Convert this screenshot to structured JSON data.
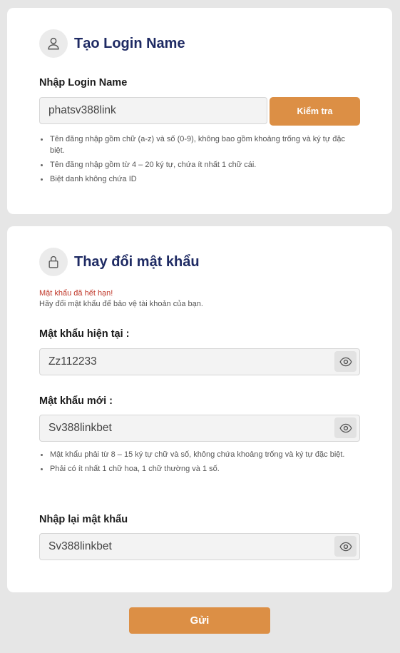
{
  "login_card": {
    "title": "Tạo Login Name",
    "icon": "user-icon",
    "field_label": "Nhập Login Name",
    "field_value": "phatsv388link",
    "check_button": "Kiểm tra",
    "notes": [
      "Tên đăng nhập gồm chữ (a-z) và số (0-9), không bao gồm khoảng trống và ký tự đặc biệt.",
      "Tên đăng nhập gồm từ 4 – 20 ký tự, chứa ít nhất 1 chữ cái.",
      "Biệt danh không chứa ID"
    ]
  },
  "password_card": {
    "title": "Thay đổi mật khẩu",
    "icon": "lock-icon",
    "expired_warning": "Mật khẩu đã hết hạn!",
    "change_hint": "Hãy đổi mật khẩu để bảo vệ tài khoản của bạn.",
    "current_label": "Mật khẩu hiện tại :",
    "current_value": "Zz112233",
    "new_label": "Mật khẩu mới :",
    "new_value": "Sv388linkbet",
    "notes": [
      "Mật khẩu phải từ 8 – 15 ký tự chữ và số, không chứa khoảng trống và ký tự đặc biệt.",
      "Phải có ít nhất 1 chữ hoa, 1 chữ thường và 1 số."
    ],
    "confirm_label": "Nhập lại mật khẩu",
    "confirm_value": "Sv388linkbet"
  },
  "submit_button": "Gửi",
  "colors": {
    "accent": "#dc8f45",
    "title": "#1e2a63",
    "warning": "#c0392b",
    "background": "#e6e6e6"
  }
}
